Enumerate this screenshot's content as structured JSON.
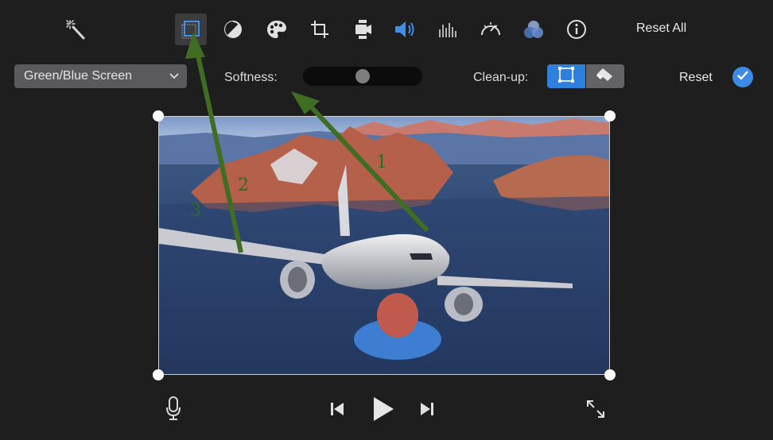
{
  "toolbar": {
    "tools": [
      {
        "name": "magic-wand-icon",
        "active": false
      },
      {
        "name": "crop-to-fill-icon",
        "active": true
      },
      {
        "name": "color-balance-icon",
        "active": false
      },
      {
        "name": "color-palette-icon",
        "active": false
      },
      {
        "name": "crop-icon",
        "active": false
      },
      {
        "name": "stabilization-camera-icon",
        "active": false
      },
      {
        "name": "volume-icon",
        "active": false
      },
      {
        "name": "equalizer-icon",
        "active": false
      },
      {
        "name": "speedometer-icon",
        "active": false
      },
      {
        "name": "color-filter-icon",
        "active": false
      },
      {
        "name": "info-icon",
        "active": false
      }
    ],
    "reset_all_label": "Reset All"
  },
  "settings": {
    "effect_dropdown": {
      "selected": "Green/Blue Screen"
    },
    "softness_label": "Softness:",
    "softness_value": 0.5,
    "cleanup_label": "Clean-up:",
    "cleanup_options": [
      "crop-region-icon",
      "eraser-icon"
    ],
    "cleanup_selected": "crop-region-icon",
    "reset_label": "Reset"
  },
  "annotations": {
    "callouts": [
      "1",
      "2",
      "3"
    ],
    "arrow_color": "#3f6e22"
  },
  "playback": {
    "controls": [
      "microphone-icon",
      "skip-back-icon",
      "play-icon",
      "skip-forward-icon",
      "fullscreen-icon"
    ]
  },
  "colors": {
    "accent": "#2f7fdc",
    "background": "#1e1e1f"
  }
}
